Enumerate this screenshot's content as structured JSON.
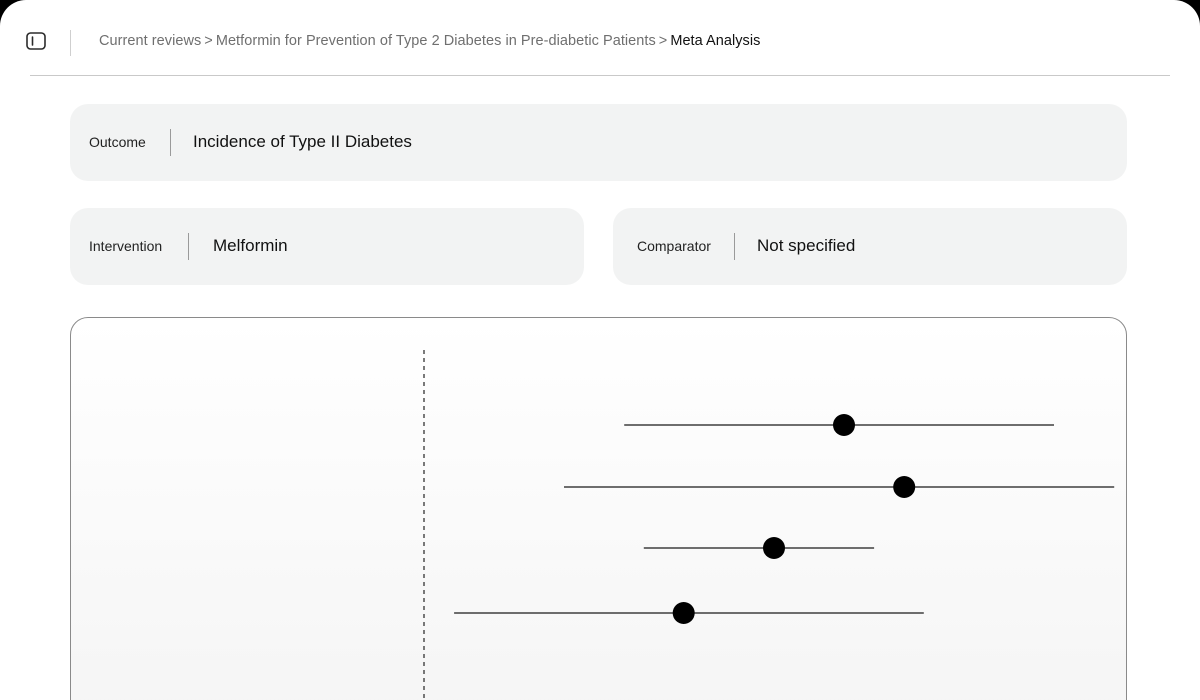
{
  "icons": {
    "sidebar_toggle": "sidebar-toggle-icon"
  },
  "breadcrumb": {
    "items": [
      "Current reviews",
      "Metformin for Prevention of Type 2 Diabetes in Pre-diabetic Patients"
    ],
    "separator": ">",
    "current": "Meta Analysis"
  },
  "pico": {
    "outcome": {
      "label": "Outcome",
      "value": "Incidence of Type II Diabetes"
    },
    "intervention": {
      "label": "Intervention",
      "value": "Melformin"
    },
    "comparator": {
      "label": "Comparator",
      "value": "Not specified"
    }
  },
  "colors": {
    "panel_background": "#f2f3f3",
    "text": "#111111",
    "muted_text": "#6f6f6f",
    "marker": "#000000"
  },
  "chart_data": {
    "type": "scatter",
    "subtype": "forest-plot",
    "reference_line": "dashed vertical null line",
    "title": "",
    "xlabel": "",
    "ylabel": "",
    "xlim": [
      0,
      1
    ],
    "series": [
      {
        "studies": [
          {
            "estimate": 0.6,
            "ci_low": 0.286,
            "ci_high": 0.9
          },
          {
            "estimate": 0.686,
            "ci_low": 0.2,
            "ci_high": 0.986
          },
          {
            "estimate": 0.5,
            "ci_low": 0.314,
            "ci_high": 0.643
          },
          {
            "estimate": 0.371,
            "ci_low": 0.043,
            "ci_high": 0.714
          }
        ]
      }
    ],
    "null_value": 0
  }
}
